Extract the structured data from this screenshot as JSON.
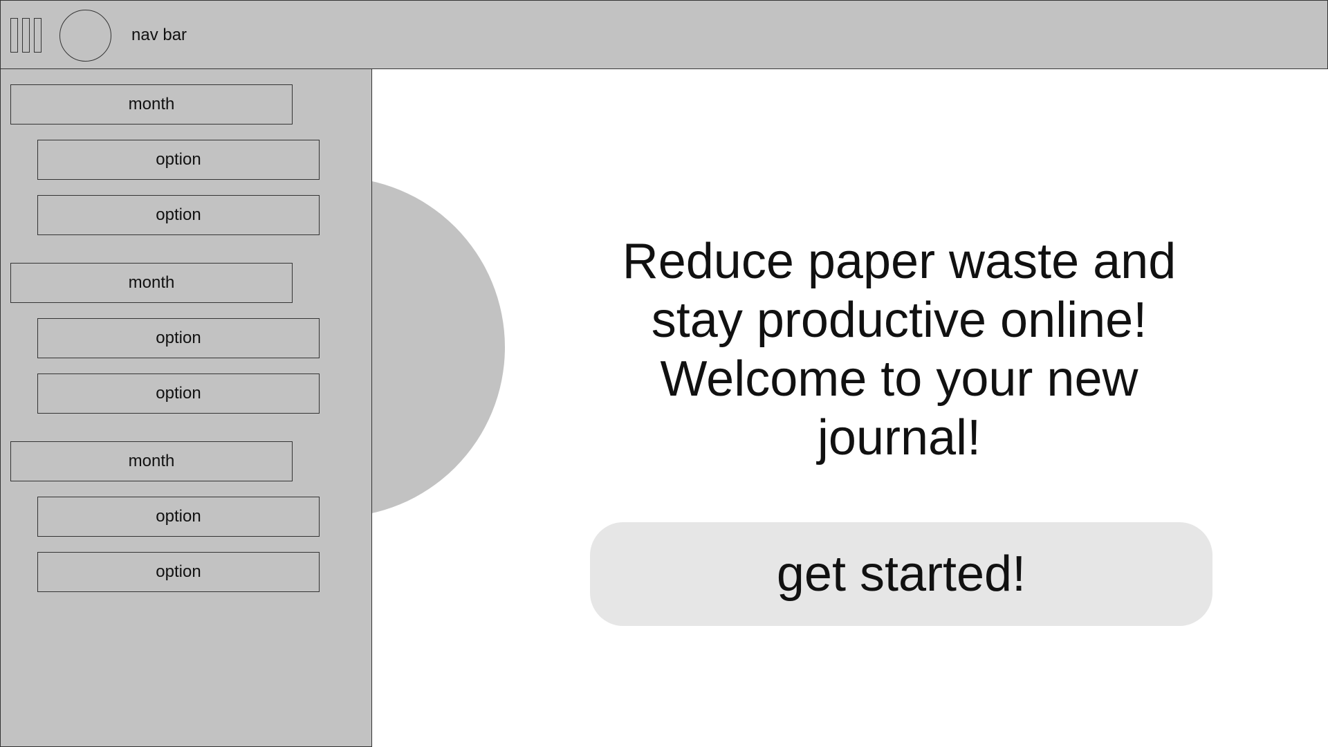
{
  "navbar": {
    "title": "nav bar",
    "menu_icon": "hamburger-menu-icon",
    "avatar_icon": "avatar-circle"
  },
  "sidebar": {
    "groups": [
      {
        "month": "month",
        "options": [
          "option",
          "option"
        ]
      },
      {
        "month": "month",
        "options": [
          "option",
          "option"
        ]
      },
      {
        "month": "month",
        "options": [
          "option",
          "option"
        ]
      }
    ]
  },
  "main": {
    "headline": "Reduce paper waste and stay productive online! Welcome to your new journal!",
    "cta_label": "get started!"
  },
  "colors": {
    "panel_gray": "#c2c2c2",
    "button_gray": "#e6e6e6",
    "background": "#ffffff"
  }
}
